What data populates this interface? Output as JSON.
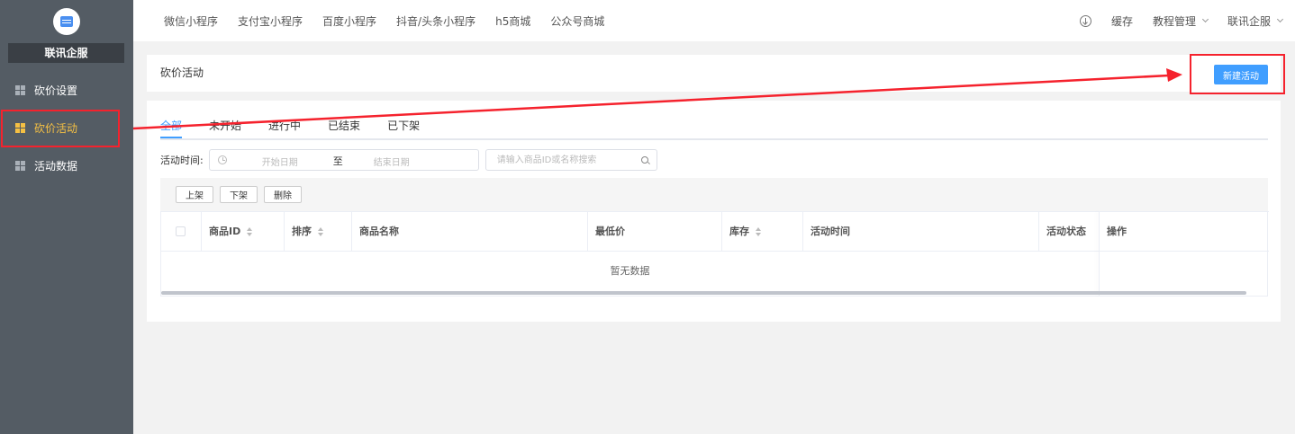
{
  "sidebar": {
    "brand": "联讯企服",
    "items": [
      {
        "label": "砍价设置"
      },
      {
        "label": "砍价活动"
      },
      {
        "label": "活动数据"
      }
    ]
  },
  "topbar": {
    "nav": [
      "微信小程序",
      "支付宝小程序",
      "百度小程序",
      "抖音/头条小程序",
      "h5商城",
      "公众号商城"
    ],
    "cache": "缓存",
    "tutorial": "教程管理",
    "account": "联讯企服"
  },
  "header": {
    "title": "砍价活动",
    "new_button": "新建活动"
  },
  "tabs": [
    "全部",
    "未开始",
    "进行中",
    "已结束",
    "已下架"
  ],
  "filter": {
    "label": "活动时间:",
    "start_placeholder": "开始日期",
    "separator": "至",
    "end_placeholder": "结束日期",
    "search_placeholder": "请输入商品ID或名称搜索"
  },
  "actions": [
    "上架",
    "下架",
    "删除"
  ],
  "table": {
    "columns": [
      "商品ID",
      "排序",
      "商品名称",
      "最低价",
      "库存",
      "活动时间",
      "活动状态",
      "操作"
    ],
    "empty_text": "暂无数据"
  },
  "colors": {
    "sidebar_bg": "#545c64",
    "active_menu": "#f5c043",
    "primary": "#409eff",
    "highlight": "#f5222d"
  }
}
